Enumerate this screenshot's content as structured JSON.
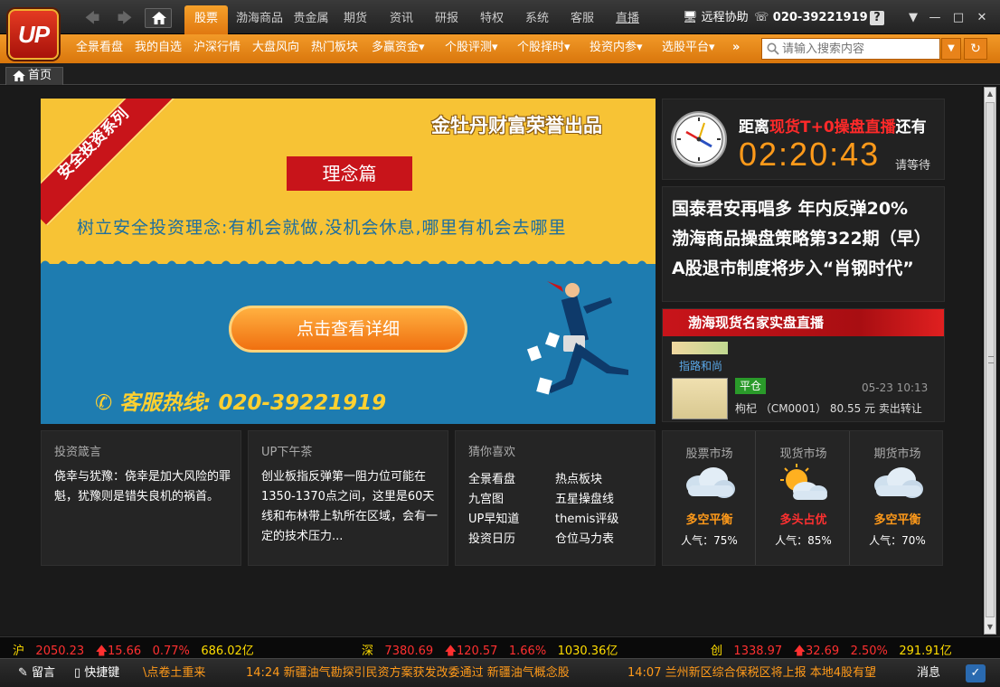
{
  "app": {
    "logo_text": "UP"
  },
  "top_tabs": [
    "股票",
    "渤海商品",
    "贵金属",
    "期货",
    "资讯",
    "研报",
    "特权",
    "系统",
    "客服",
    "直播"
  ],
  "header": {
    "remote_label": "远程协助",
    "phone": "020-39221919"
  },
  "sub_menu": [
    "全景看盘",
    "我的自选",
    "沪深行情",
    "大盘风向",
    "热门板块",
    "多赢资金▾",
    "个股评测▾",
    "个股择时▾",
    "投资内参▾",
    "选股平台▾",
    "»"
  ],
  "search": {
    "placeholder": "请输入搜索内容"
  },
  "page_tab": {
    "label": "首页"
  },
  "banner": {
    "ribbon": "安全投资系列",
    "brand": "金牡丹财富荣誉出品",
    "tag": "理念篇",
    "slogan": "树立安全投资理念:有机会就做,没机会休息,哪里有机会去哪里",
    "button": "点击查看详细",
    "hotline": "客服热线: 020-39221919"
  },
  "countdown": {
    "prefix": "距离",
    "highlight": "现货T+0操盘直播",
    "suffix": "还有",
    "time": "02:20:43",
    "wait": "请等待"
  },
  "headlines": [
    "国泰君安再唱多 年内反弹20%",
    "渤海商品操盘策略第322期（早）",
    "A股退市制度将步入“肖钢时代”"
  ],
  "live": {
    "title": "渤海现货名家实盘直播",
    "name1": "指路和尚",
    "badge": "平仓",
    "time": "05-23 10:13",
    "trade": "枸杞 （CM0001） 80.55 元 卖出转让"
  },
  "cards": {
    "proverb": {
      "title": "投资箴言",
      "body": "侥幸与犹豫：侥幸是加大风险的罪魁，犹豫则是错失良机的祸首。"
    },
    "tea": {
      "title": "UP下午茶",
      "body": "创业板指反弹第一阻力位可能在1350-1370点之间，这里是60天线和布林带上轨所在区域，会有一定的技术压力..."
    },
    "likes": {
      "title": "猜你喜欢",
      "links": [
        "全景看盘",
        "热点板块",
        "九宫图",
        "五星操盘线",
        "UP早知道",
        "themis评级",
        "投资日历",
        "仓位马力表"
      ]
    }
  },
  "markets": [
    {
      "title": "股票市场",
      "status": "多空平衡",
      "popularity": "人气：75%",
      "status_color": "#ff9a1a",
      "icon": "cloudy-icon"
    },
    {
      "title": "现货市场",
      "status": "多头占优",
      "popularity": "人气：85%",
      "status_color": "#ff3030",
      "icon": "sun-cloud-icon"
    },
    {
      "title": "期货市场",
      "status": "多空平衡",
      "popularity": "人气：70%",
      "status_color": "#ff9a1a",
      "icon": "cloudy-icon"
    }
  ],
  "indices": [
    {
      "name": "沪",
      "value": "2050.23",
      "change": "15.66",
      "pct": "0.77%",
      "amount": "686.02亿"
    },
    {
      "name": "深",
      "value": "7380.69",
      "change": "120.57",
      "pct": "1.66%",
      "amount": "1030.36亿"
    },
    {
      "name": "创",
      "value": "1338.97",
      "change": "32.69",
      "pct": "2.50%",
      "amount": "291.91亿"
    }
  ],
  "statusbar": {
    "message_board": "留言",
    "shortcut": "快捷键",
    "news1": "\\点卷土重来",
    "news2": "14:24  新疆油气勘探引民资方案获发改委通过 新疆油气概念股",
    "news3": "14:07  兰州新区综合保税区将上报 本地4股有望",
    "messages": "消息"
  },
  "colors": {
    "accent": "#f08a1c",
    "red": "#c8141a",
    "banner_yellow": "#f7c335",
    "banner_blue": "#1e7cb0"
  }
}
